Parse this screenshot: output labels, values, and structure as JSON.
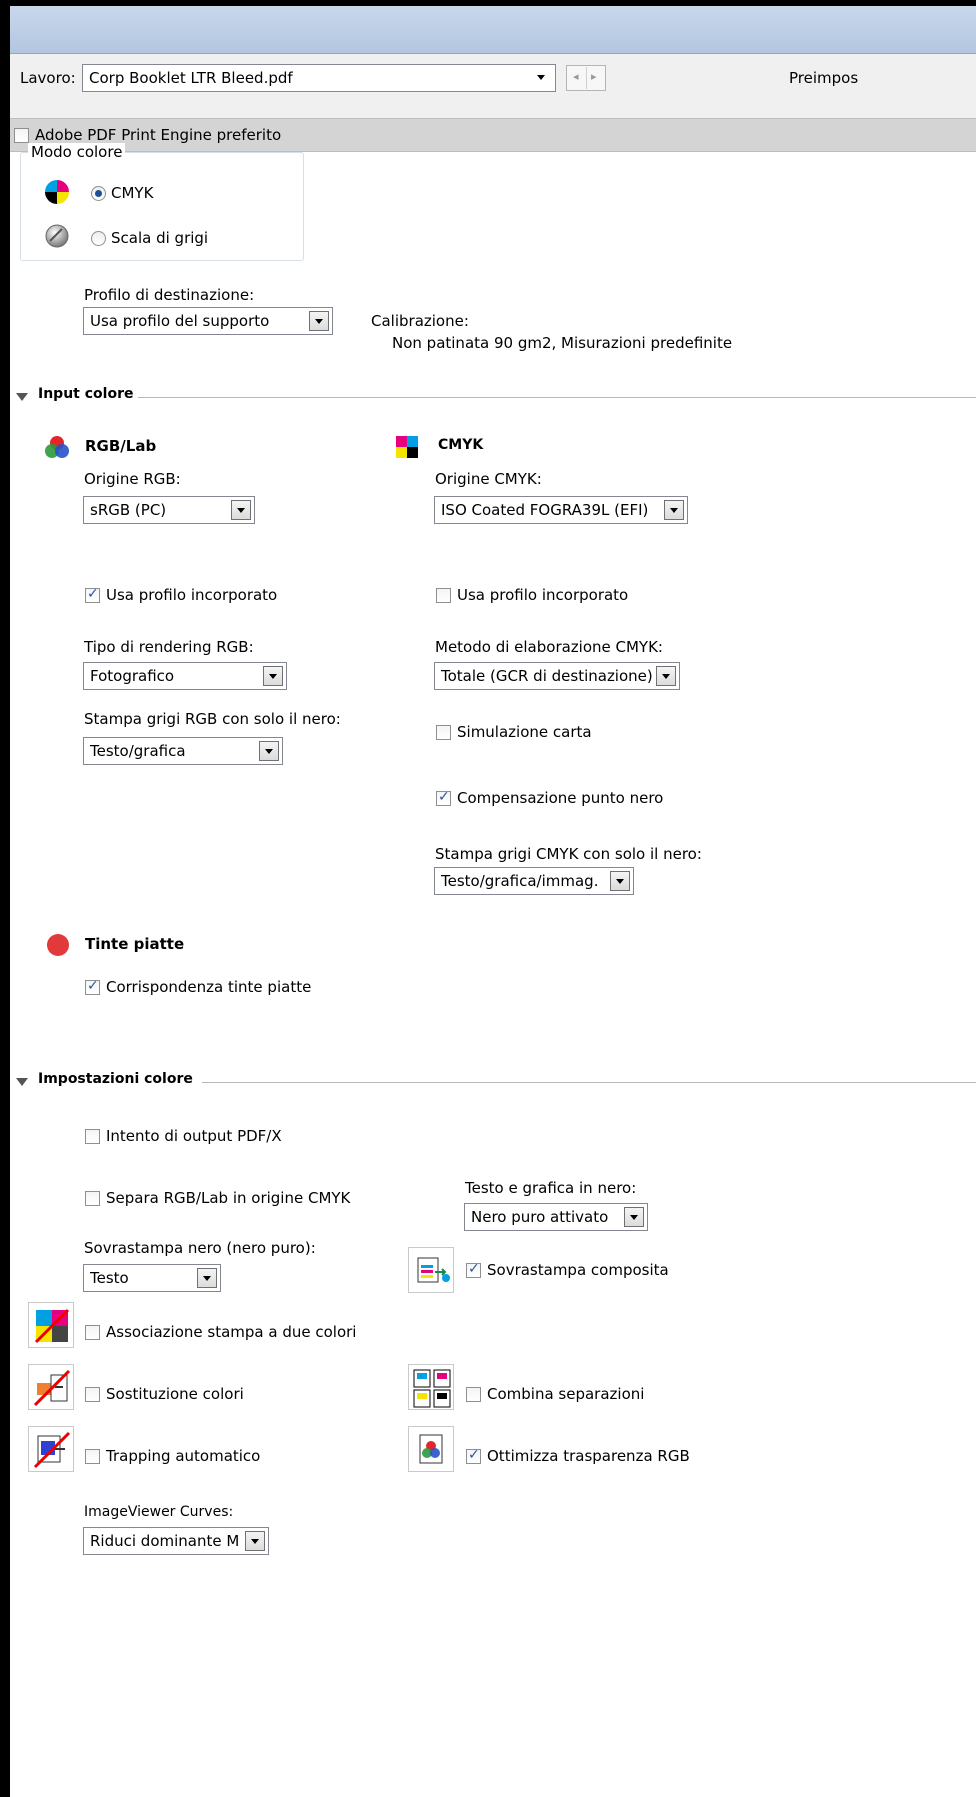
{
  "toolbar": {
    "job_label": "Lavoro:",
    "job_value": "Corp Booklet LTR Bleed.pdf",
    "preset_label": "Preimpos"
  },
  "engine": {
    "label": "Adobe PDF Print Engine preferito",
    "checked": false
  },
  "color_mode": {
    "legend": "Modo colore",
    "cmyk_label": "CMYK",
    "gray_label": "Scala di grigi"
  },
  "destination": {
    "label": "Profilo di destinazione:",
    "value": "Usa profilo del supporto",
    "calibration_label": "Calibrazione:",
    "calibration_value": "Non patinata 90 gm2, Misurazioni predefinite"
  },
  "input_color": {
    "title": "Input colore",
    "rgb": {
      "heading": "RGB/Lab",
      "source_label": "Origine RGB:",
      "source_value": "sRGB (PC)",
      "embedded_label": "Usa profilo incorporato",
      "rendering_label": "Tipo di rendering RGB:",
      "rendering_value": "Fotografico",
      "gray_label": "Stampa grigi RGB con solo il nero:",
      "gray_value": "Testo/grafica"
    },
    "cmyk": {
      "heading": "CMYK",
      "source_label": "Origine CMYK:",
      "source_value": "ISO Coated FOGRA39L (EFI)",
      "embedded_label": "Usa profilo incorporato",
      "method_label": "Metodo di elaborazione CMYK:",
      "method_value": "Totale (GCR di destinazione)",
      "paper_sim_label": "Simulazione carta",
      "black_point_label": "Compensazione punto nero",
      "gray_label": "Stampa grigi CMYK con solo il nero:",
      "gray_value": "Testo/grafica/immag."
    },
    "spot": {
      "heading": "Tinte piatte",
      "match_label": "Corrispondenza tinte piatte"
    }
  },
  "color_settings": {
    "title": "Impostazioni colore",
    "pdfx_label": "Intento di output PDF/X",
    "separate_label": "Separa RGB/Lab in origine CMYK",
    "black_text_label": "Testo e grafica in nero:",
    "black_text_value": "Nero puro attivato",
    "overprint_black_label": "Sovrastampa nero (nero puro):",
    "overprint_black_value": "Testo",
    "composite_label": "Sovrastampa composita",
    "two_color_label": "Associazione stampa a due colori",
    "substitution_label": "Sostituzione colori",
    "combine_label": "Combina separazioni",
    "trapping_label": "Trapping automatico",
    "optimize_label": "Ottimizza trasparenza RGB",
    "curves_label": "ImageViewer Curves:",
    "curves_value": "Riduci dominante M"
  }
}
